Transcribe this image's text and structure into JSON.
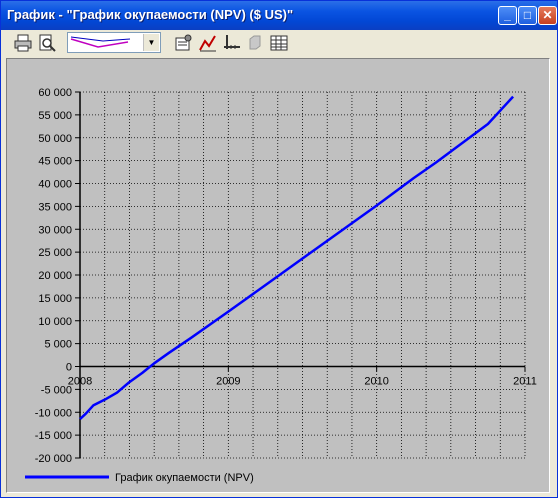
{
  "window": {
    "title": "График - \"График окупаемости (NPV) ($ US)\"",
    "controls": {
      "minimize": "_",
      "maximize": "□",
      "close": "✕"
    }
  },
  "toolbar": {
    "icons": [
      "print-icon",
      "print-preview-icon",
      "chart-type-combo",
      "chart-settings-icon",
      "series-icon",
      "axis-icon",
      "layers-icon",
      "table-icon"
    ]
  },
  "chart_data": {
    "type": "line",
    "x_ticks": [
      "2008",
      "2009",
      "2010",
      "2011"
    ],
    "y_ticks": [
      "60 000",
      "55 000",
      "50 000",
      "45 000",
      "40 000",
      "35 000",
      "30 000",
      "25 000",
      "20 000",
      "15 000",
      "10 000",
      "5 000",
      "0",
      "-5 000",
      "-10 000",
      "-15 000",
      "-20 000"
    ],
    "xlim": [
      2008,
      2011
    ],
    "ylim": [
      -20000,
      60000
    ],
    "grid": true,
    "legend_position": "bottom-left",
    "series": [
      {
        "name": "График окупаемости (NPV)",
        "color": "#0000ff",
        "x": [
          2008.0,
          2008.04,
          2008.09,
          2008.17,
          2008.25,
          2008.33,
          2008.42,
          2008.5,
          2008.6,
          2008.75,
          2009.0,
          2009.25,
          2009.5,
          2009.75,
          2010.0,
          2010.25,
          2010.4,
          2010.5,
          2010.75,
          2010.92
        ],
        "values": [
          -11500,
          -10300,
          -8500,
          -7200,
          -5700,
          -3500,
          -1400,
          700,
          3000,
          6300,
          12000,
          17800,
          23600,
          29400,
          35200,
          41200,
          44600,
          47000,
          53000,
          59000
        ]
      }
    ]
  }
}
